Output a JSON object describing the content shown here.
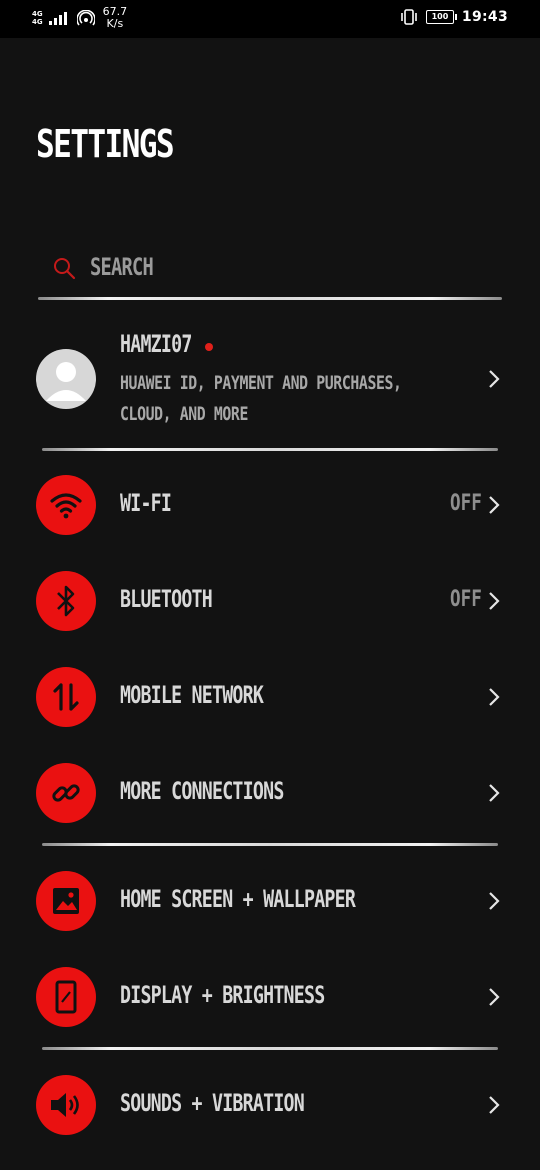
{
  "status_bar": {
    "network_type": "4G",
    "network_sub": "4G",
    "speed_value": "67.7",
    "speed_unit": "K/s",
    "battery": "100",
    "time": "19:43"
  },
  "page_title": "SETTINGS",
  "search": {
    "placeholder": "SEARCH"
  },
  "account": {
    "name": "HAMZI07",
    "subtitle_line1": "HUAWEI ID, PAYMENT AND PURCHASES,",
    "subtitle_line2": "CLOUD, AND MORE"
  },
  "items": [
    {
      "label": "WI-FI",
      "status": "OFF",
      "icon": "wifi-icon"
    },
    {
      "label": "BLUETOOTH",
      "status": "OFF",
      "icon": "bluetooth-icon"
    },
    {
      "label": "MOBILE NETWORK",
      "status": "",
      "icon": "mobile-data-icon"
    },
    {
      "label": "MORE CONNECTIONS",
      "status": "",
      "icon": "link-icon"
    },
    {
      "label": "HOME SCREEN + WALLPAPER",
      "status": "",
      "icon": "image-icon"
    },
    {
      "label": "DISPLAY + BRIGHTNESS",
      "status": "",
      "icon": "phone-display-icon"
    },
    {
      "label": "SOUNDS + VIBRATION",
      "status": "",
      "icon": "speaker-icon"
    }
  ],
  "colors": {
    "accent": "#ea1111",
    "background": "#121212",
    "text": "#d8d8d8"
  }
}
